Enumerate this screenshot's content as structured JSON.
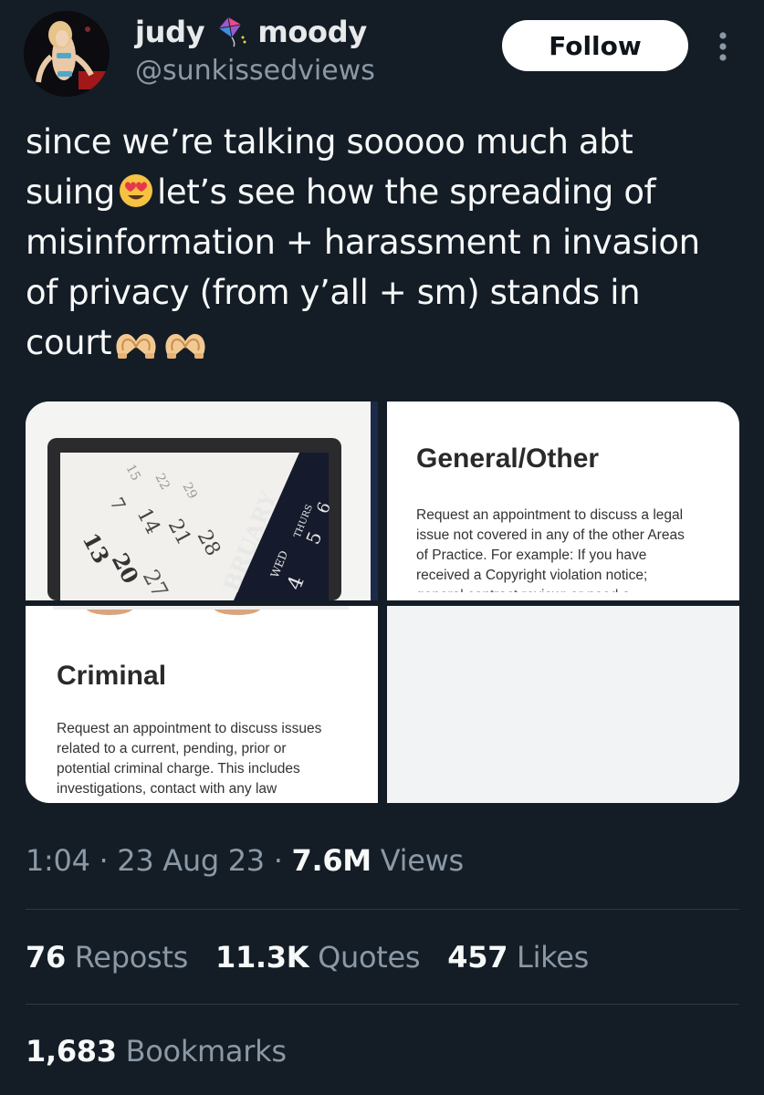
{
  "author": {
    "display_name_first": "judy",
    "display_name_last": "moody",
    "handle": "@sunkissedviews",
    "avatar_icon": "profile-photo",
    "name_emoji_icon": "kite-icon"
  },
  "header": {
    "follow_label": "Follow",
    "more_icon": "more-vertical-icon"
  },
  "tweet": {
    "line1": "since we’re talking sooooo much abt",
    "line2_before": "suing",
    "line2_after": "let’s see how the spreading of",
    "line3": "misinformation + harassment n invasion",
    "line4": "of privacy (from y’all + sm) stands in",
    "line5": "court",
    "emoji_1": "heart-eyes-emoji",
    "emoji_2": "heart-hands-emoji"
  },
  "media": {
    "calendar_month": "BRUARY",
    "calendar_days": [
      "7",
      "14",
      "21",
      "28",
      "13",
      "20",
      "27",
      "6",
      "5",
      "4",
      "15",
      "22",
      "29"
    ],
    "calendar_weekdays": [
      "WED",
      "THURS"
    ],
    "general": {
      "title": "General/Other",
      "lines": [
        "Request an appointment to discuss a legal",
        "issue not covered in any of the other Areas",
        "of Practice. For example: If you have",
        "received a Copyright violation notice;",
        "general contract review; or need a"
      ]
    },
    "criminal": {
      "title": "Criminal",
      "lines": [
        "Request an appointment to discuss issues",
        "related to a current, pending, prior or",
        "potential criminal charge. This includes",
        "investigations, contact with any law"
      ]
    }
  },
  "meta": {
    "time": "1:04",
    "sep1": " · ",
    "date": "23 Aug 23",
    "sep2": " · ",
    "views_count": "7.6M",
    "views_label": " Views"
  },
  "stats": {
    "reposts_count": "76",
    "reposts_label": " Reposts",
    "quotes_count": "11.3K",
    "quotes_label": " Quotes",
    "likes_count": "457",
    "likes_label": " Likes",
    "bookmarks_count": "1,683",
    "bookmarks_label": " Bookmarks"
  },
  "colors": {
    "background": "#141d26",
    "secondary_text": "#8b98a5",
    "primary_text": "#f7f9f9",
    "follow_bg": "#ffffff"
  }
}
